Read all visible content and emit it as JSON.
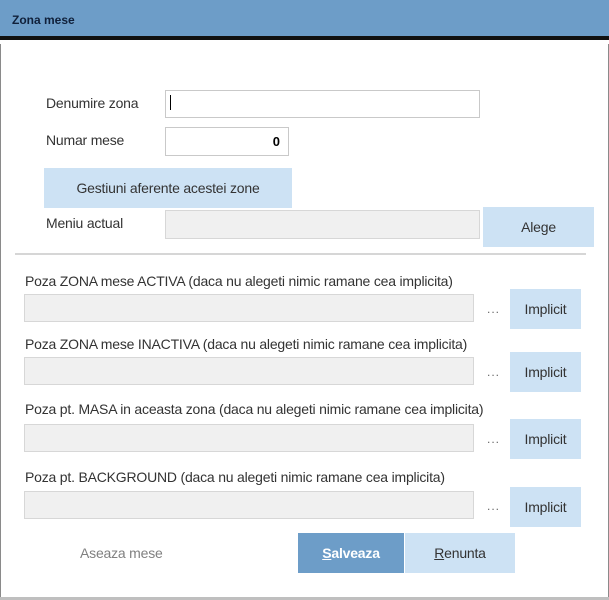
{
  "window": {
    "title": "Zona mese"
  },
  "form": {
    "denumire_label": "Denumire zona",
    "denumire_value": "",
    "numar_label": "Numar mese",
    "numar_value": "0",
    "gestiuni_button": "Gestiuni aferente acestei zone",
    "meniu_label": "Meniu actual",
    "meniu_value": "",
    "alege_button": "Alege"
  },
  "images": [
    {
      "label": "Poza ZONA mese ACTIVA (daca nu alegeti nimic ramane cea implicita)",
      "value": "",
      "browse": "...",
      "default_button": "Implicit"
    },
    {
      "label": "Poza ZONA mese INACTIVA (daca nu alegeti nimic ramane cea implicita)",
      "value": "",
      "browse": "...",
      "default_button": "Implicit"
    },
    {
      "label": "Poza pt. MASA in aceasta zona (daca nu alegeti nimic ramane cea implicita)",
      "value": "",
      "browse": "...",
      "default_button": "Implicit"
    },
    {
      "label": "Poza pt. BACKGROUND (daca nu alegeti nimic ramane cea implicita)",
      "value": "",
      "browse": "...",
      "default_button": "Implicit"
    }
  ],
  "footer": {
    "aseaza_label": "Aseaza mese",
    "salveaza_first": "S",
    "salveaza_rest": "alveaza",
    "renunta_first": "R",
    "renunta_rest": "enunta"
  },
  "colors": {
    "accent": "#6d9dc8",
    "button_light": "#cde2f4",
    "field_readonly": "#f0f0f0"
  }
}
